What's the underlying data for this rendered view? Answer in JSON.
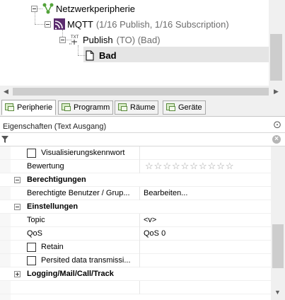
{
  "tree": {
    "items": [
      {
        "label": "Netzwerkperipherie",
        "suffix": ""
      },
      {
        "label": "MQTT",
        "suffix": "(1/16 Publish, 1/16 Subscription)"
      },
      {
        "label": "Publish",
        "suffix": "(TO) (Bad)"
      },
      {
        "label": "Bad",
        "suffix": ""
      }
    ]
  },
  "tabs": [
    {
      "label": "Peripherie",
      "active": true
    },
    {
      "label": "Programm",
      "active": false
    },
    {
      "label": "Räume",
      "active": false
    },
    {
      "label": "Geräte",
      "active": false
    }
  ],
  "properties": {
    "title": "Eigenschaften (Text Ausgang)",
    "pin_glyph": "⨀",
    "rows": {
      "visualisierungskennwort": "Visualisierungskennwort",
      "bewertung": "Bewertung",
      "rating": 0,
      "rating_max": 10,
      "cat_berechtigungen": "Berechtigungen",
      "berechtigte_benutzer": "Berechtigte Benutzer / Grup...",
      "berechtigte_benutzer_value": "Bearbeiten...",
      "cat_einstellungen": "Einstellungen",
      "topic": "Topic",
      "topic_value": "<v>",
      "qos": "QoS",
      "qos_value": "QoS 0",
      "retain": "Retain",
      "persisted": "Persited data transmissi...",
      "cat_logging": "Logging/Mail/Call/Track"
    }
  }
}
